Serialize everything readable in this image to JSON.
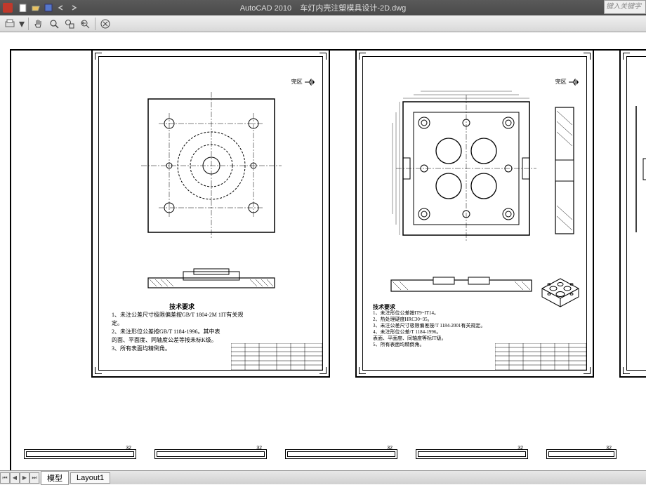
{
  "app": {
    "title_prefix": "AutoCAD 2010",
    "file_name": "车灯内壳注塑模具设计-2D.dwg",
    "search_placeholder": "键入关键字"
  },
  "qat": {
    "new": "新建",
    "open": "打开",
    "save": "保存",
    "undo": "撤销",
    "redo": "重做"
  },
  "toolbar": {
    "print": "打印",
    "pan": "平移",
    "zoom": "缩放",
    "zoom_window": "窗口缩放",
    "zoom_prev": "上一视图",
    "close": "关闭"
  },
  "tabs": {
    "model": "模型",
    "layout1": "Layout1"
  },
  "sheet1": {
    "marker": "完区",
    "notes_title": "技术要求",
    "note1": "1、未注公差尺寸极限偏差按GB/T 1804-2M 1IT有关规定。",
    "note2": "2、未注形位公差按GB/T 1184-1996。其中表",
    "note2b": "   的面、平面度、同轴度公差等按未标K级。",
    "note3": "3、所有表面均精倒角。"
  },
  "sheet2": {
    "marker": "完区",
    "notes_title": "技术要求",
    "note1": "1、未注形位公差按IT9~IT14。",
    "note2": "2、热处理硬度HRC30~35。",
    "note3": "3、未注公差尺寸极限偏差按/T 1184-2001有关规定。",
    "note4": "4、未注形位公差/T 1184-1996。",
    "note5": "   表面、平面度、同轴度等标IT级。",
    "note6": "5、所有表面均精倒角。"
  },
  "thumbs": {
    "label": "32"
  }
}
